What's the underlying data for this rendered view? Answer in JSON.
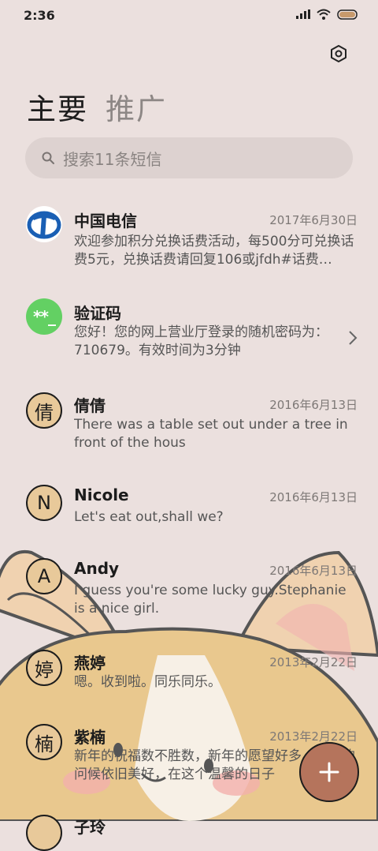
{
  "status_bar": {
    "time": "2:36"
  },
  "tabs": [
    {
      "label": "主要",
      "active": true
    },
    {
      "label": "推广",
      "active": false
    }
  ],
  "search": {
    "placeholder": "搜索11条短信"
  },
  "conversations": [
    {
      "avatar": "china-telecom-logo",
      "name": "中国电信",
      "date": "2017年6月30日",
      "preview": "欢迎参加积分兑换话费活动，每500分可兑换话费5元，兑换话费请回复106或jfdh#话费…"
    },
    {
      "avatar": "**_",
      "name": "验证码",
      "date": "",
      "preview": "您好！您的网上营业厅登录的随机密码为：710679。有效时间为3分钟"
    },
    {
      "avatar": "倩",
      "name": "倩倩",
      "date": "2016年6月13日",
      "preview": "There was a table set out under a tree in front of the hous"
    },
    {
      "avatar": "N",
      "name": "Nicole",
      "date": "2016年6月13日",
      "preview": "Let's eat out,shall we?"
    },
    {
      "avatar": "A",
      "name": "Andy",
      "date": "2016年6月13日",
      "preview": "I guess you're some lucky guy.Stephanie is a nice girl."
    },
    {
      "avatar": "婷",
      "name": "燕婷",
      "date": "2013年2月22日",
      "preview": "嗯。收到啦。同乐同乐。"
    },
    {
      "avatar": "楠",
      "name": "紫楠",
      "date": "2013年2月22日",
      "preview": "新年的祝福数不胜数，新年的愿望好多，新年的问候依旧美好，在这个温馨的日子"
    },
    {
      "avatar": "",
      "name": "子玲",
      "date": "",
      "preview": ""
    }
  ],
  "colors": {
    "background": "#ebe0de",
    "avatar_fill": "#e8c99a",
    "verification_avatar": "#63d063",
    "fab": "#b5745c"
  }
}
